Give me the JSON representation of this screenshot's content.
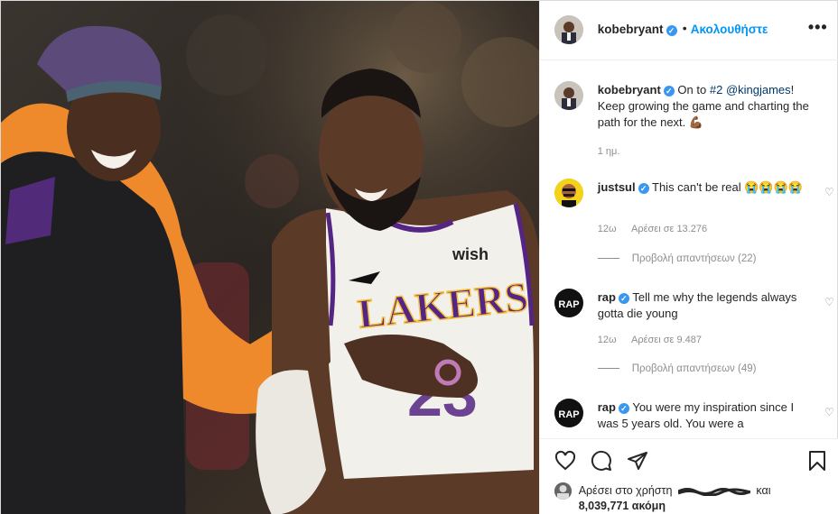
{
  "post": {
    "username": "kobebryant",
    "verified": true,
    "separator": "•",
    "follow_label": "Ακολουθήστε",
    "more_label": "•••"
  },
  "caption": {
    "username": "kobebryant",
    "text_prefix": "On to ",
    "hashtag": "#2",
    "mention": "@kingjames",
    "text_suffix": "! Keep growing the game and charting the path for the next.",
    "emoji": "💪🏾",
    "time": "1 ημ."
  },
  "comments": [
    {
      "username": "justsul",
      "text": "This can't be real 😭😭😭😭",
      "time": "12ω",
      "likes": "Αρέσει σε 13.276",
      "replies": "Προβολή απαντήσεων (22)"
    },
    {
      "username": "rap",
      "text": "Tell me why the legends always gotta die young",
      "time": "12ω",
      "likes": "Αρέσει σε 9.487",
      "replies": "Προβολή απαντήσεων (49)"
    },
    {
      "username": "rap",
      "text": "You were my inspiration since I was 5 years old. You were a"
    }
  ],
  "likes_bar": {
    "prefix": "Αρέσει στο χρήστη",
    "and": "και",
    "count": "8,039,771 ακόμη"
  },
  "photo": {
    "jersey_sponsor": "wish",
    "jersey_team": "LAKERS"
  },
  "colors": {
    "accent": "#0095f6",
    "verified": "#3897f0",
    "hoodie": "#f08a2a",
    "jersey": "#f2f0ea",
    "jersey_trim": "#552583"
  }
}
